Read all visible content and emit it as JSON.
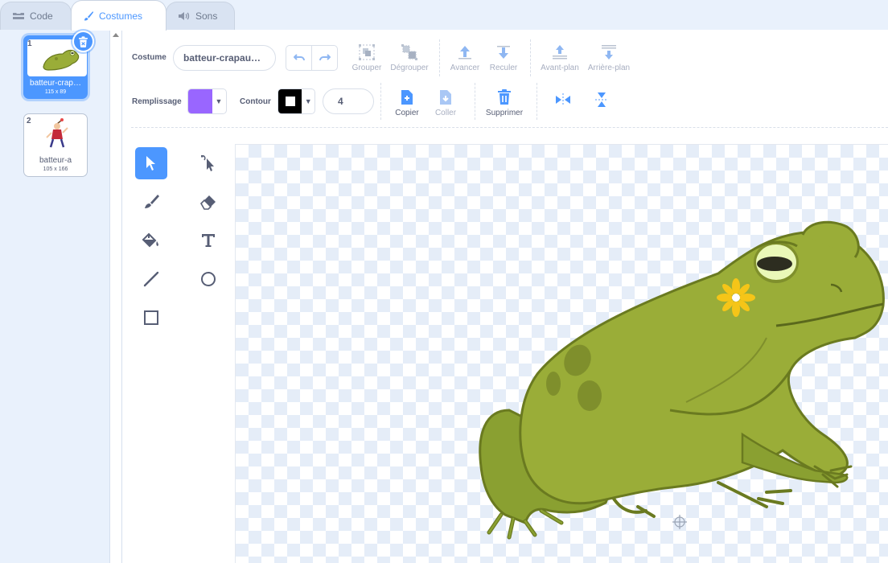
{
  "tabs": [
    {
      "label": "Code",
      "icon": "code-icon",
      "active": false
    },
    {
      "label": "Costumes",
      "icon": "paintbrush-icon",
      "active": true
    },
    {
      "label": "Sons",
      "icon": "speaker-icon",
      "active": false
    }
  ],
  "costumes": [
    {
      "number": "1",
      "name": "batteur-crap…",
      "size": "115 x 89",
      "selected": true
    },
    {
      "number": "2",
      "name": "batteur-a",
      "size": "105 x 166",
      "selected": false
    }
  ],
  "editor": {
    "costume_label": "Costume",
    "costume_name": "batteur-crapau…",
    "group_label": "Grouper",
    "ungroup_label": "Dégrouper",
    "forward_label": "Avancer",
    "backward_label": "Reculer",
    "front_label": "Avant-plan",
    "back_label": "Arrière-plan",
    "fill_label": "Remplissage",
    "fill_color": "#9966ff",
    "outline_label": "Contour",
    "outline_color": "#000000",
    "outline_width": "4",
    "copy_label": "Copier",
    "paste_label": "Coller",
    "delete_label": "Supprimer"
  },
  "colors": {
    "accent": "#4c97ff",
    "frog_body": "#9aad38",
    "frog_outline": "#6a7a20",
    "frog_spots": "#7f8f2c",
    "flower": "#f5c518"
  }
}
